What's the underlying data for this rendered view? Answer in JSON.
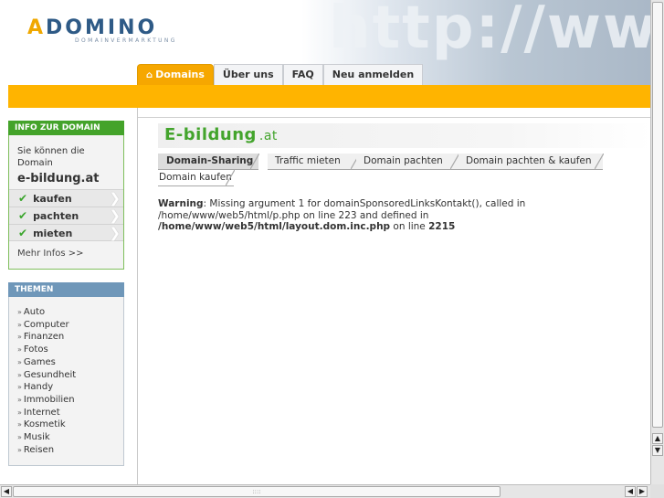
{
  "brand": {
    "logo_text": "ADOMINO",
    "logo_first": "A",
    "logo_rest": "DOMINO",
    "tagline": "DOMAINVERMARKTUNG",
    "watermark": "http://www",
    "accent_orange": "#ffb400",
    "accent_green": "#43a42c"
  },
  "nav": {
    "items": [
      {
        "label": "Domains",
        "icon": "home-icon",
        "active": true
      },
      {
        "label": "Über uns"
      },
      {
        "label": "FAQ"
      },
      {
        "label": "Neu anmelden"
      }
    ]
  },
  "sidebar": {
    "info_heading": "INFO ZUR DOMAIN",
    "intro": "Sie können die Domain",
    "domain": "e-bildung.at",
    "actions": [
      {
        "label": "kaufen",
        "icon": "check-icon"
      },
      {
        "label": "pachten",
        "icon": "check-icon"
      },
      {
        "label": "mieten",
        "icon": "check-icon"
      }
    ],
    "more": "Mehr Infos >>",
    "themes_heading": "THEMEN",
    "themes": [
      "Auto",
      "Computer",
      "Finanzen",
      "Fotos",
      "Games",
      "Gesundheit",
      "Handy",
      "Immobilien",
      "Internet",
      "Kosmetik",
      "Musik",
      "Reisen"
    ]
  },
  "main": {
    "title": "E-bildung",
    "tld": ".at",
    "tabs": [
      {
        "label": "Domain-Sharing",
        "active": true
      },
      {
        "label": "Traffic mieten"
      },
      {
        "label": "Domain pachten"
      },
      {
        "label": "Domain pachten & kaufen"
      },
      {
        "label": "Domain kaufen"
      }
    ],
    "warning": {
      "label": "Warning",
      "text1": ": Missing argument 1 for domainSponsoredLinksKontakt(), called in /home/www/web5/html/p.php on line 223 and defined in ",
      "path": "/home/www/web5/html/layout.dom.inc.php",
      "text2": " on line ",
      "line": "2215"
    }
  },
  "scrollbar": {
    "up": "▲",
    "down": "▼",
    "left": "◀",
    "right": "▶",
    "grip": "::::"
  }
}
